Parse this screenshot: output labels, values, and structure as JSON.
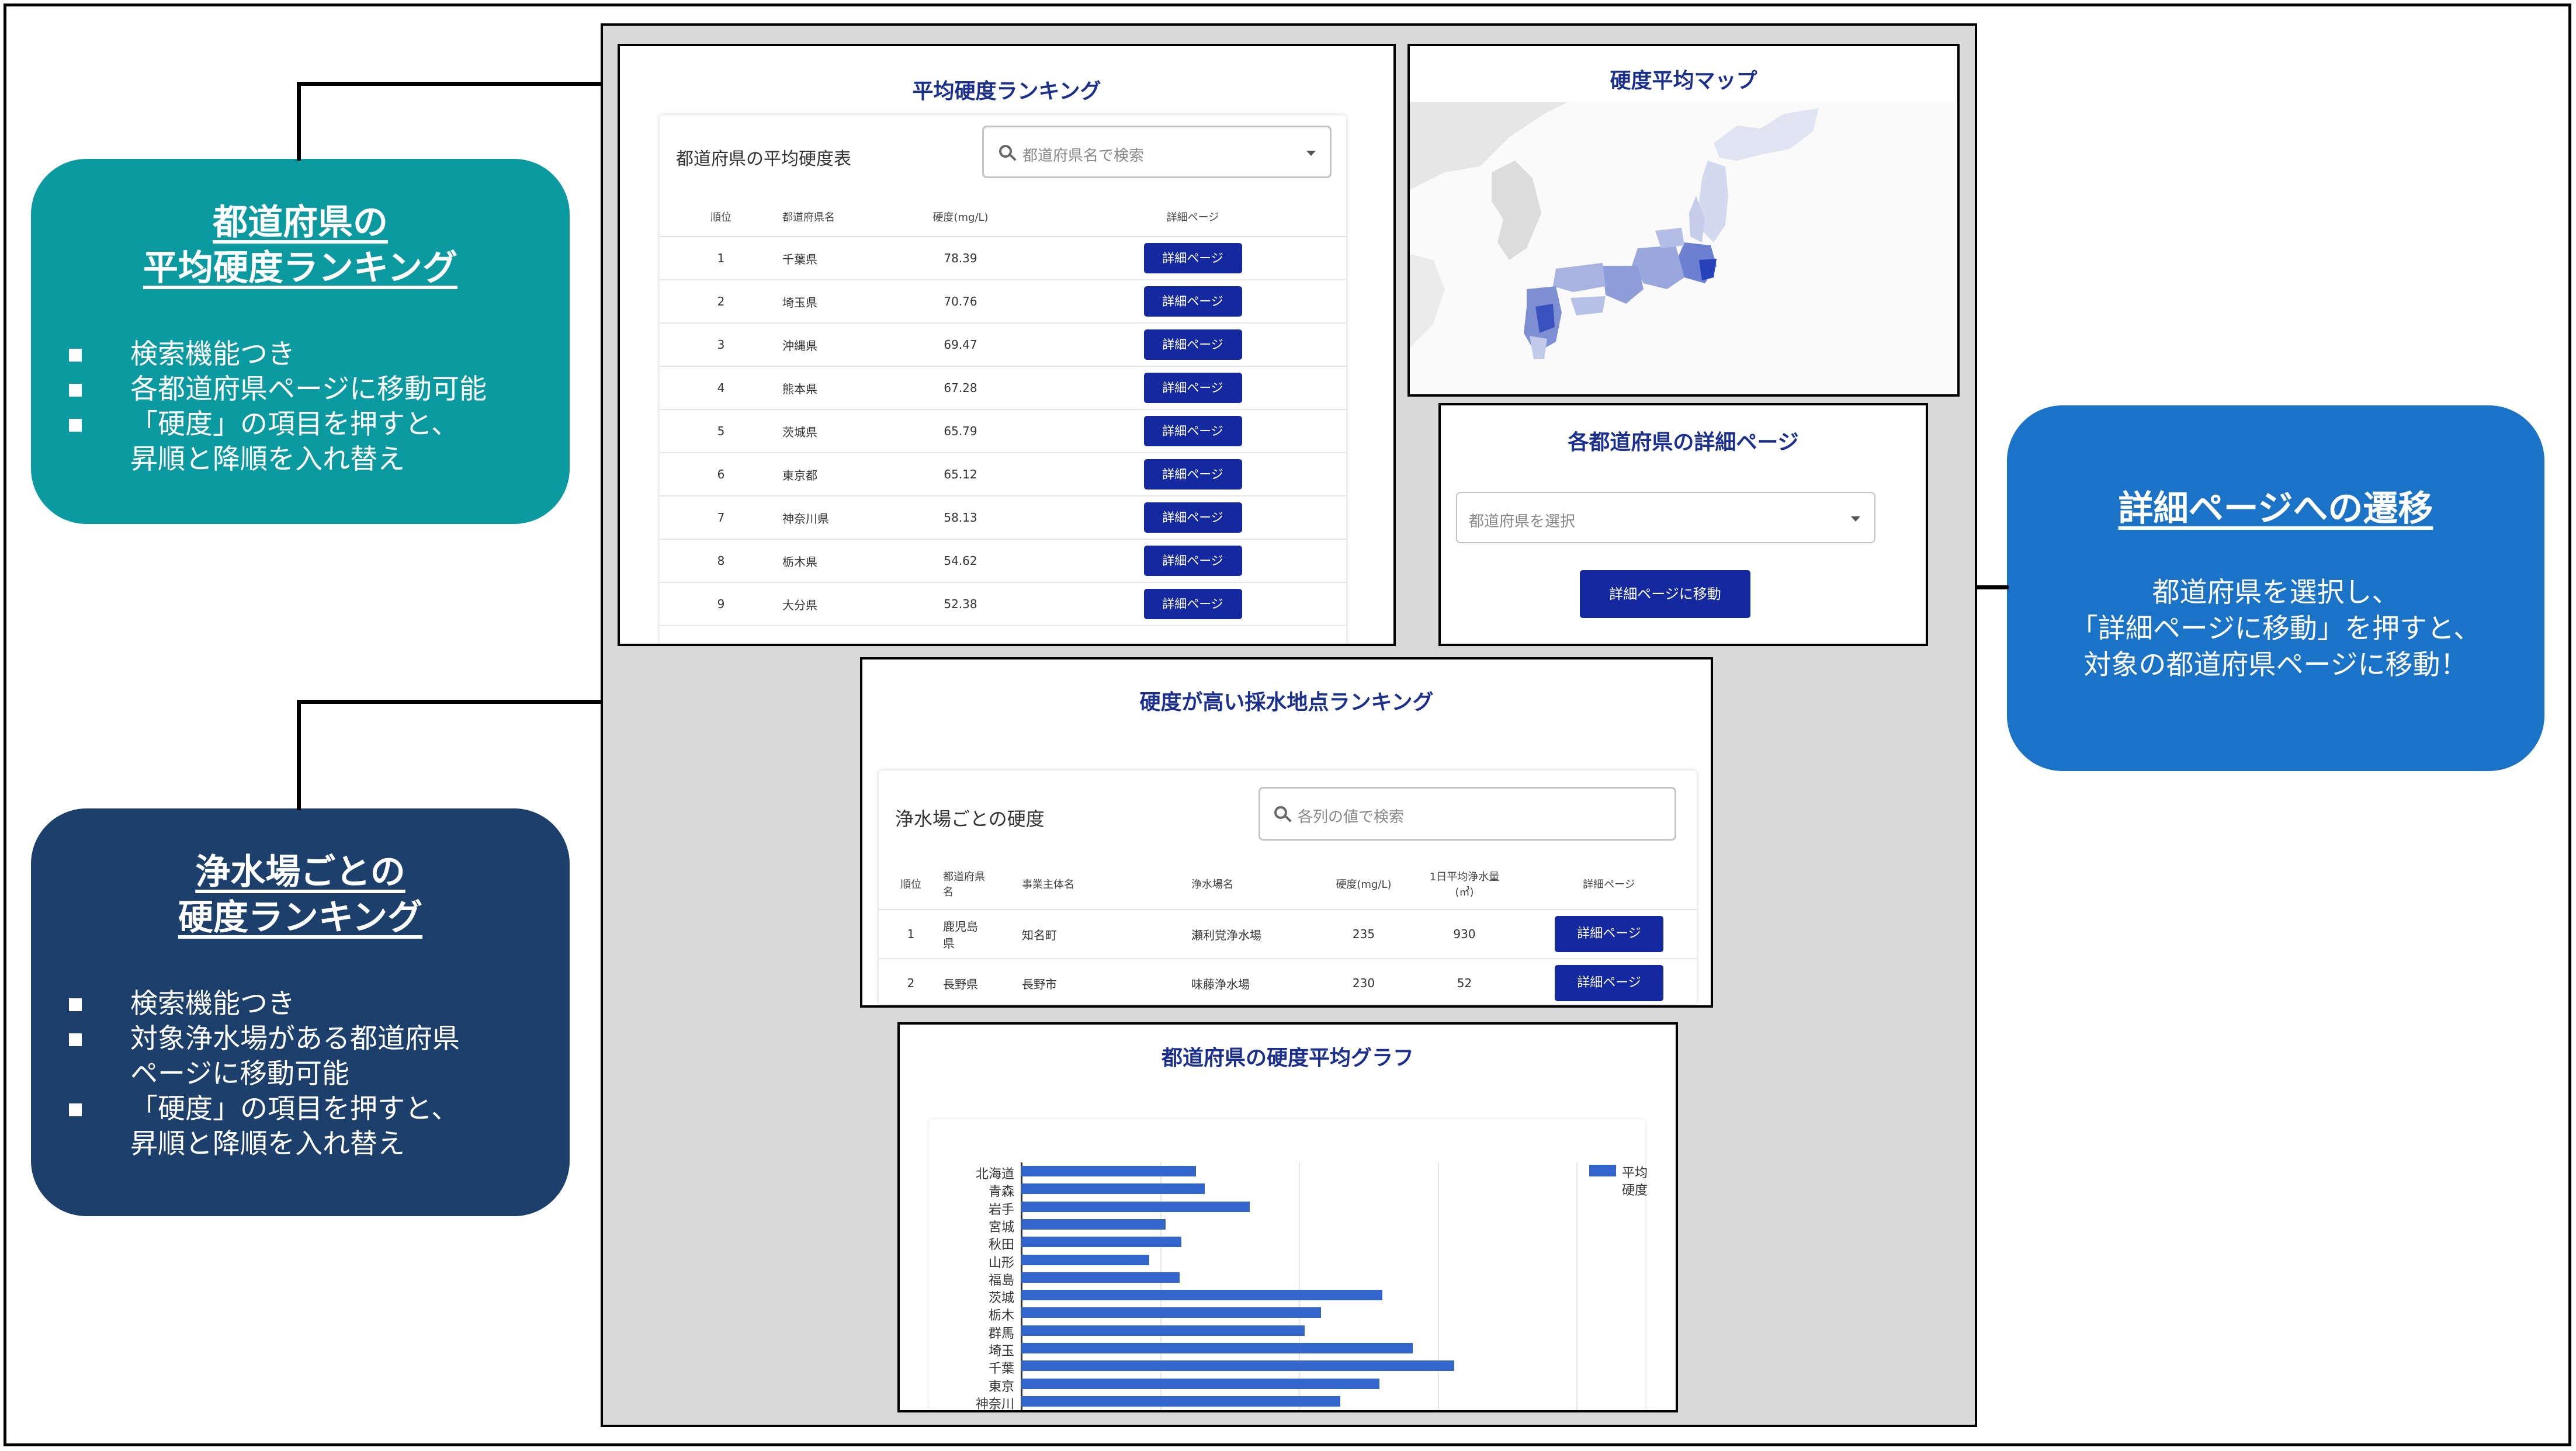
{
  "callouts": {
    "prefecture_ranking": {
      "title_line1": "都道府県の",
      "title_line2": "平均硬度ランキング",
      "bullets": [
        {
          "l1": "検索機能つき",
          "l2": ""
        },
        {
          "l1": "各都道府県ページに移動可能",
          "l2": ""
        },
        {
          "l1": "「硬度」の項目を押すと、",
          "l2": "昇順と降順を入れ替え"
        }
      ],
      "color": "#0a9aa0"
    },
    "plant_ranking": {
      "title_line1": "浄水場ごとの",
      "title_line2": "硬度ランキング",
      "bullets": [
        {
          "l1": "検索機能つき",
          "l2": ""
        },
        {
          "l1": "対象浄水場がある都道府県",
          "l2": "ページに移動可能"
        },
        {
          "l1": "「硬度」の項目を押すと、",
          "l2": "昇順と降順を入れ替え"
        }
      ],
      "color": "#1c3f6b"
    },
    "detail_transition": {
      "title": "詳細ページへの遷移",
      "body": [
        "都道府県を選択し、",
        "「詳細ページに移動」を押すと、",
        "対象の都道府県ページに移動！"
      ],
      "color": "#1a73c7"
    }
  },
  "ranking_panel": {
    "title": "平均硬度ランキング",
    "card_title": "都道府県の平均硬度表",
    "search_placeholder": "都道府県名で検索",
    "columns": [
      "順位",
      "都道府県名",
      "硬度(mg/L)",
      "詳細ページ"
    ],
    "button_label": "詳細ページ",
    "rows": [
      {
        "rank": "1",
        "name": "千葉県",
        "hardness": "78.39"
      },
      {
        "rank": "2",
        "name": "埼玉県",
        "hardness": "70.76"
      },
      {
        "rank": "3",
        "name": "沖縄県",
        "hardness": "69.47"
      },
      {
        "rank": "4",
        "name": "熊本県",
        "hardness": "67.28"
      },
      {
        "rank": "5",
        "name": "茨城県",
        "hardness": "65.79"
      },
      {
        "rank": "6",
        "name": "東京都",
        "hardness": "65.12"
      },
      {
        "rank": "7",
        "name": "神奈川県",
        "hardness": "58.13"
      },
      {
        "rank": "8",
        "name": "栃木県",
        "hardness": "54.62"
      },
      {
        "rank": "9",
        "name": "大分県",
        "hardness": "52.38"
      }
    ]
  },
  "map_panel": {
    "title": "硬度平均マップ"
  },
  "detail_panel": {
    "title": "各都道府県の詳細ページ",
    "select_placeholder": "都道府県を選択",
    "button_label": "詳細ページに移動"
  },
  "plant_panel": {
    "title": "硬度が高い採水地点ランキング",
    "card_title": "浄水場ごとの硬度",
    "search_placeholder": "各列の値で検索",
    "columns": {
      "rank": "順位",
      "pref_l1": "都道府県",
      "pref_l2": "名",
      "operator": "事業主体名",
      "plant": "浄水場名",
      "hardness": "硬度(mg/L)",
      "volume_l1": "1日平均浄水量",
      "volume_l2": "(㎥)",
      "detail": "詳細ページ"
    },
    "button_label": "詳細ページ",
    "rows": [
      {
        "rank": "1",
        "pref_l1": "鹿児島",
        "pref_l2": "県",
        "operator": "知名町",
        "plant": "瀬利覚浄水場",
        "hardness": "235",
        "volume": "930"
      },
      {
        "rank": "2",
        "pref_l1": "長野県",
        "pref_l2": "",
        "operator": "長野市",
        "plant": "味藤浄水場",
        "hardness": "230",
        "volume": "52"
      }
    ]
  },
  "graph_panel": {
    "title": "都道府県の硬度平均グラフ"
  },
  "chart_data": {
    "type": "bar",
    "orientation": "horizontal",
    "categories": [
      "北海道",
      "青森",
      "岩手",
      "宮城",
      "秋田",
      "山形",
      "福島",
      "茨城",
      "栃木",
      "群馬",
      "埼玉",
      "千葉",
      "東京",
      "神奈川"
    ],
    "series": [
      {
        "name_l1": "平均",
        "name_l2": "硬度",
        "values": [
          31.5,
          33.0,
          41.2,
          26.0,
          28.8,
          23.0,
          28.5,
          65.0,
          54.0,
          51.0,
          70.5,
          78.0,
          64.5,
          57.5
        ],
        "color": "#3366cc"
      }
    ],
    "xlim": [
      0,
      100
    ],
    "legend": "right",
    "grid": true
  }
}
